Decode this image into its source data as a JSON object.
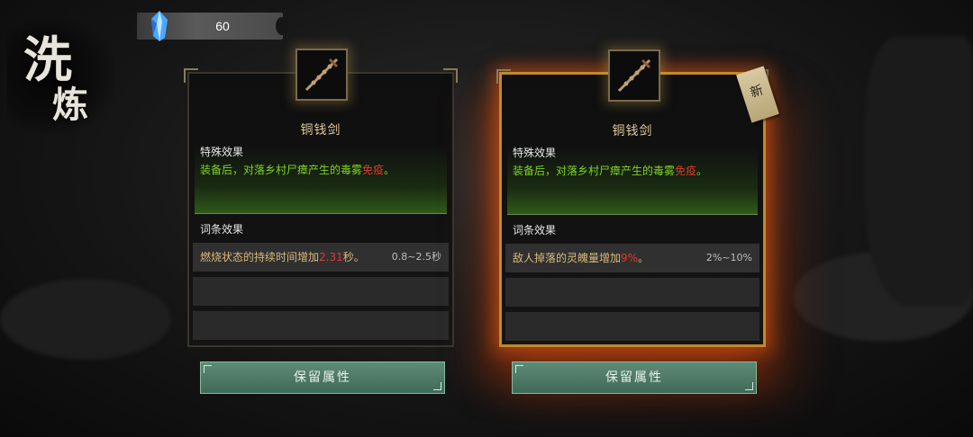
{
  "title": {
    "char1": "洗",
    "char2": "炼"
  },
  "currency": {
    "icon": "blue-crystal-icon",
    "value": "60"
  },
  "cards": [
    {
      "item_name": "铜钱剑",
      "special_label": "特殊效果",
      "special_effect_pre": "装备后，对落乡村尸瘴产生的毒雾",
      "special_effect_hl": "免疫",
      "special_effect_post": "。",
      "affix_label": "词条效果",
      "affix_text_pre": "燃烧状态的持续时间增加",
      "affix_value": "2.31",
      "affix_text_post": "秒。",
      "affix_range": "0.8~2.5秒",
      "keep_button": "保留属性"
    },
    {
      "item_name": "铜钱剑",
      "special_label": "特殊效果",
      "special_effect_pre": "装备后，对落乡村尸瘴产生的毒雾",
      "special_effect_hl": "免疫",
      "special_effect_post": "。",
      "affix_label": "词条效果",
      "affix_text_pre": "敌人掉落的灵魄量增加",
      "affix_value": "9%",
      "affix_text_post": "。",
      "affix_range": "2%~10%",
      "new_tag": "新",
      "keep_button": "保留属性"
    }
  ],
  "colors": {
    "green_text": "#7ed321",
    "highlight_red": "#e03a2a",
    "gold_border": "#c08a2c",
    "button": "#4f7a66"
  }
}
